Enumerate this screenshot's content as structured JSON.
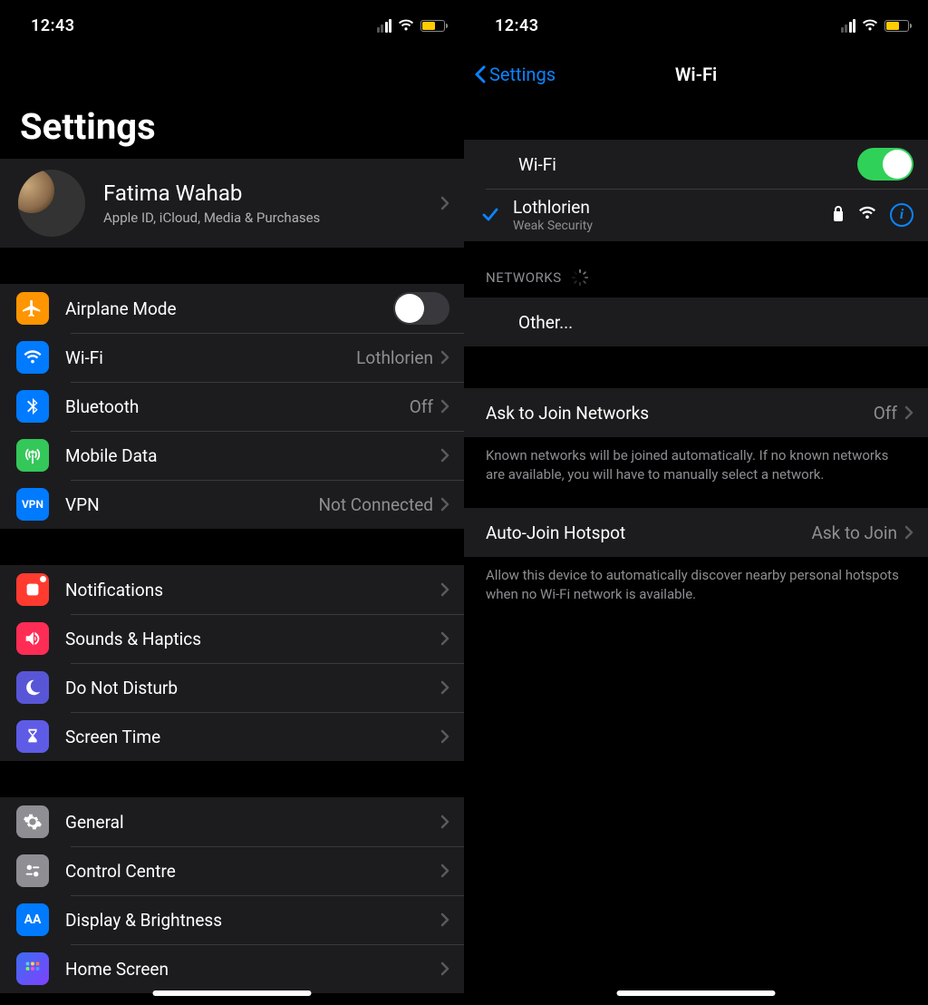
{
  "status": {
    "time": "12:43"
  },
  "left": {
    "title": "Settings",
    "profile": {
      "name": "Fatima Wahab",
      "sub": "Apple ID, iCloud, Media & Purchases"
    },
    "group1": {
      "airplane": {
        "label": "Airplane Mode"
      },
      "wifi": {
        "label": "Wi-Fi",
        "value": "Lothlorien"
      },
      "bluetooth": {
        "label": "Bluetooth",
        "value": "Off"
      },
      "mobile": {
        "label": "Mobile Data"
      },
      "vpn": {
        "label": "VPN",
        "value": "Not Connected"
      }
    },
    "group2": {
      "notifications": {
        "label": "Notifications"
      },
      "sounds": {
        "label": "Sounds & Haptics"
      },
      "dnd": {
        "label": "Do Not Disturb"
      },
      "screentime": {
        "label": "Screen Time"
      }
    },
    "group3": {
      "general": {
        "label": "General"
      },
      "control": {
        "label": "Control Centre"
      },
      "display": {
        "label": "Display & Brightness"
      },
      "home": {
        "label": "Home Screen"
      }
    }
  },
  "right": {
    "back_label": "Settings",
    "title": "Wi-Fi",
    "wifi_toggle_label": "Wi-Fi",
    "connected": {
      "name": "Lothlorien",
      "sub": "Weak Security"
    },
    "networks_header": "NETWORKS",
    "other_label": "Other...",
    "ask_join": {
      "label": "Ask to Join Networks",
      "value": "Off"
    },
    "ask_join_footer": "Known networks will be joined automatically. If no known networks are available, you will have to manually select a network.",
    "auto_hotspot": {
      "label": "Auto-Join Hotspot",
      "value": "Ask to Join"
    },
    "auto_hotspot_footer": "Allow this device to automatically discover nearby personal hotspots when no Wi-Fi network is available."
  }
}
